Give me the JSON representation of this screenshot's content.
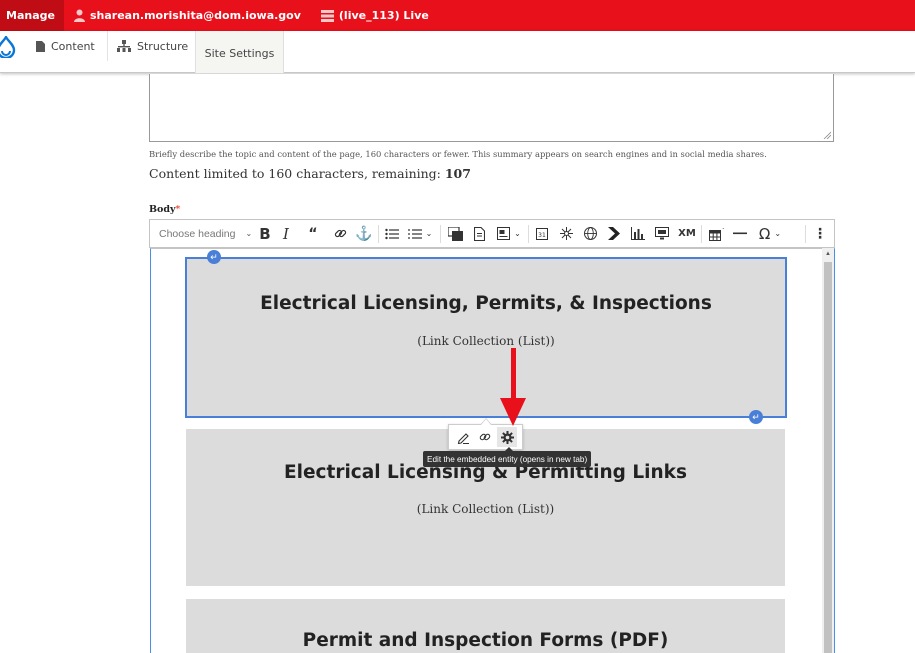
{
  "admin_bar": {
    "manage_label": "Manage",
    "user": "sharean.morishita@dom.iowa.gov",
    "environment": "(live_113) Live",
    "user_icon": "person-icon",
    "env_icon": "stack-icon",
    "background": "#e8101b"
  },
  "toolbar_tray": {
    "logo": "drupal-drop-icon",
    "content_label": "Content",
    "structure_label": "Structure",
    "site_settings_label": "Site Settings"
  },
  "summary": {
    "description": "Briefly describe the topic and content of the page, 160 characters or fewer. This summary appears on search engines and in social media shares.",
    "counter_prefix": "Content limited to 160 characters, remaining: ",
    "remaining": "107"
  },
  "body_field": {
    "label": "Body",
    "required_marker": "*"
  },
  "editor_toolbar": {
    "heading_placeholder": "Choose heading",
    "buttons": [
      "bold",
      "italic",
      "blockquote",
      "link",
      "anchor",
      "bulleted-list",
      "numbered-list",
      "embed-media",
      "embed-document",
      "image-style",
      "calendar",
      "drupal-entity",
      "globe",
      "chevron",
      "chart",
      "media-embed",
      "xml",
      "insert-table",
      "horizontal-line",
      "special-characters",
      "more"
    ]
  },
  "editor_content": {
    "widgets": [
      {
        "title": "Electrical Licensing, Permits, & Inspections",
        "subtitle": "(Link Collection (List))"
      },
      {
        "title": "Electrical Licensing & Permitting Links",
        "subtitle": "(Link Collection (List))"
      },
      {
        "title": "Permit and Inspection Forms (PDF)",
        "subtitle": ""
      }
    ]
  },
  "balloon": {
    "tooltip": "Edit the embedded entity (opens in new tab)",
    "accent": "#4a7fd8",
    "arrow_color": "#e8101b"
  }
}
